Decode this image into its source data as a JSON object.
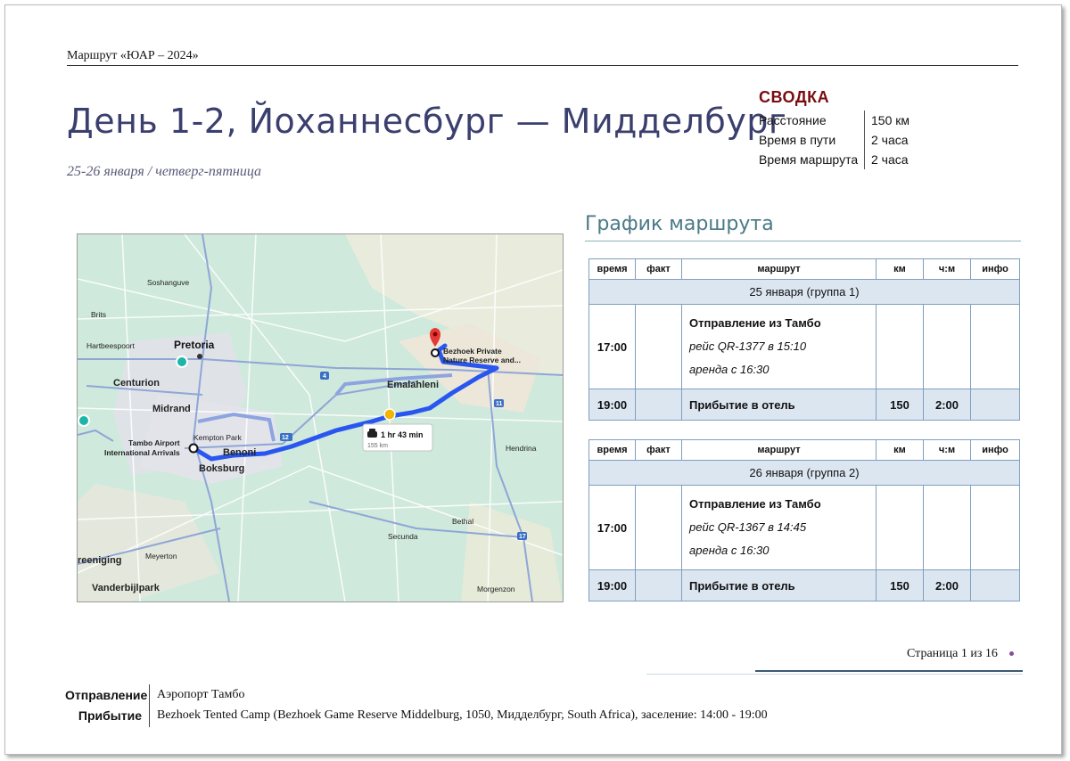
{
  "header": {
    "doc_title": "Маршрут «ЮАР – 2024»"
  },
  "day": {
    "title": "День 1-2, Йоханнесбург — Мидделбург",
    "subtitle": "25-26 января / четверг-пятница"
  },
  "summary": {
    "title": "СВОДКА",
    "rows": [
      {
        "key": "Расстояние",
        "value": "150 км"
      },
      {
        "key": "Время в пути",
        "value": "2 часа"
      },
      {
        "key": "Время маршрута",
        "value": "2 часа"
      }
    ]
  },
  "map": {
    "labels": {
      "soshanguve": "Soshanguve",
      "brits": "Brits",
      "hartbeespoort": "Hartbeespoort",
      "pretoria": "Pretoria",
      "centurion": "Centurion",
      "midrand": "Midrand",
      "kempton_park": "Kempton Park",
      "tambo_airport_1": "Tambo Airport",
      "tambo_airport_2": "International Arrivals",
      "benoni": "Benoni",
      "boksburg": "Boksburg",
      "emalahleni": "Emalahleni",
      "bezhoek_1": "Bezhoek Private",
      "bezhoek_2": "Nature Reserve and...",
      "hendrina": "Hendrina",
      "bethal": "Bethal",
      "secunda": "Secunda",
      "meyerton": "Meyerton",
      "vereeniging": "reeniging",
      "vanderbijlpark": "Vanderbijlpark",
      "morgenzon": "Morgenzon",
      "road_12": "12",
      "road_4": "4",
      "road_11": "11",
      "road_17": "17"
    },
    "route_time": "1 hr 43 min",
    "route_distance": "155 km",
    "icons": [
      "car-icon",
      "destination-pin-icon",
      "origin-marker-icon",
      "toll-icon"
    ]
  },
  "schedule": {
    "title": "График маршрута",
    "columns": [
      "время",
      "факт",
      "маршрут",
      "км",
      "ч:м",
      "инфо"
    ],
    "tables": [
      {
        "date": "25 января (группа 1)",
        "departure": {
          "time": "17:00",
          "line1": "Отправление из Тамбо",
          "line2": "рейс QR-1377 в 15:10",
          "line3": "аренда с 16:30"
        },
        "arrival": {
          "time": "19:00",
          "route": "Прибытие в отель",
          "km": "150",
          "hm": "2:00"
        }
      },
      {
        "date": "26 января (группа 2)",
        "departure": {
          "time": "17:00",
          "line1": "Отправление из Тамбо",
          "line2": "рейс QR-1367 в 14:45",
          "line3": "аренда с 16:30"
        },
        "arrival": {
          "time": "19:00",
          "route": "Прибытие в отель",
          "km": "150",
          "hm": "2:00"
        }
      }
    ]
  },
  "footer": {
    "page": "Страница 1 из 16",
    "departure_label": "Отправление",
    "departure_value": "Аэропорт Тамбо",
    "arrival_label": "Прибытие",
    "arrival_value": "Bezhoek Tented Camp (Bezhoek Game Reserve Middelburg, 1050, Мидделбург, South Africa), заселение: 14:00 - 19:00"
  },
  "colors": {
    "title": "#3b3f6e",
    "summary_title": "#7a0c10",
    "schedule_title": "#4a7a87",
    "table_border": "#7e9fbf",
    "table_fill": "#dce6f1",
    "route_line": "#2a56f0"
  }
}
